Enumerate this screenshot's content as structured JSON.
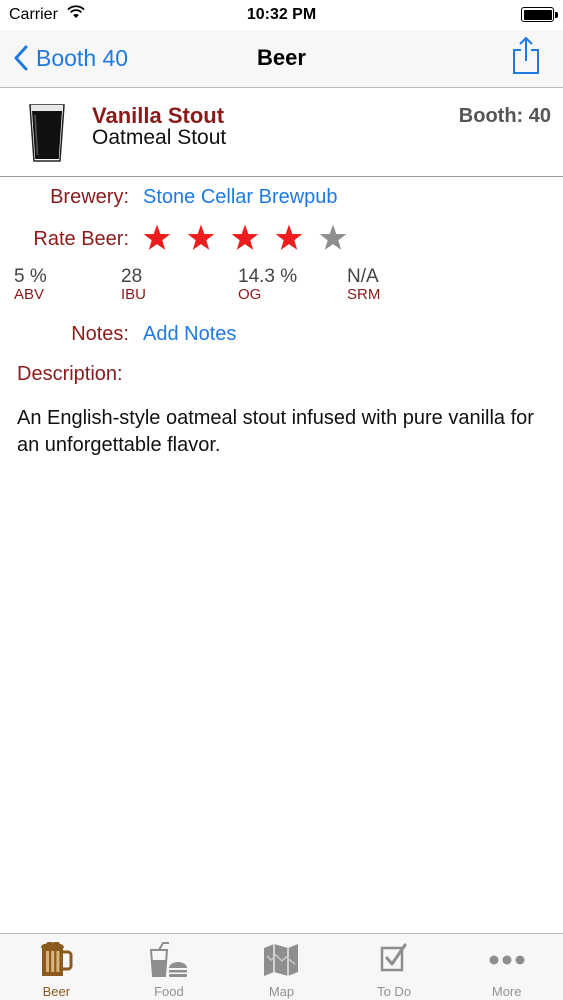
{
  "status_bar": {
    "carrier": "Carrier",
    "time": "10:32 PM"
  },
  "nav": {
    "back_label": "Booth 40",
    "title": "Beer"
  },
  "beer": {
    "name": "Vanilla Stout",
    "style": "Oatmeal Stout",
    "booth": "Booth: 40",
    "brewery_label": "Brewery:",
    "brewery": "Stone Cellar Brewpub",
    "rate_label": "Rate Beer:",
    "rating": {
      "value": 4,
      "max": 5
    },
    "stats": [
      {
        "value": "5 %",
        "label": "ABV"
      },
      {
        "value": "28",
        "label": "IBU"
      },
      {
        "value": "14.3 %",
        "label": "OG"
      },
      {
        "value": "N/A",
        "label": "SRM"
      }
    ],
    "notes_label": "Notes:",
    "notes_action": "Add Notes",
    "description_label": "Description:",
    "description": "An English-style oatmeal stout infused with pure vanilla for an unforgettable flavor."
  },
  "colors": {
    "accent": "#1e7ae0",
    "label": "#8b1b1b",
    "star_on": "#ee1c1c",
    "star_off": "#8e8e8e",
    "tab_active": "#8b5a1e"
  },
  "tabs": [
    {
      "label": "Beer",
      "icon": "beer-mug-icon",
      "active": true
    },
    {
      "label": "Food",
      "icon": "food-drink-icon",
      "active": false
    },
    {
      "label": "Map",
      "icon": "map-icon",
      "active": false
    },
    {
      "label": "To Do",
      "icon": "checklist-icon",
      "active": false
    },
    {
      "label": "More",
      "icon": "more-dots-icon",
      "active": false
    }
  ]
}
